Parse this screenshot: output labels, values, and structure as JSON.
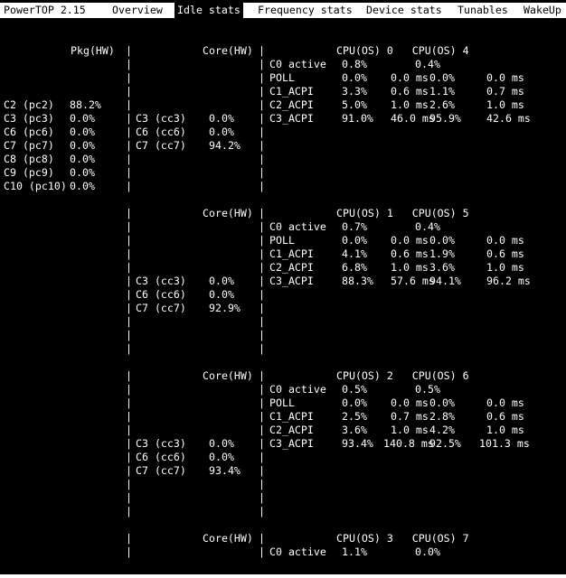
{
  "tabs": {
    "app_title": "PowerTOP 2.15",
    "overview": "Overview",
    "idle_stats": "Idle stats",
    "frequency_stats": "Frequency stats",
    "device_stats": "Device stats",
    "tunables": "Tunables",
    "wakeup": "WakeUp"
  },
  "separator": "|",
  "package": {
    "header": "Pkg(HW)",
    "states": [
      {
        "label": "C2 (pc2)",
        "value": "88.2%"
      },
      {
        "label": "C3 (pc3)",
        "value": "0.0%"
      },
      {
        "label": "C6 (pc6)",
        "value": "0.0%"
      },
      {
        "label": "C7 (pc7)",
        "value": "0.0%"
      },
      {
        "label": "C8 (pc8)",
        "value": "0.0%"
      },
      {
        "label": "C9 (pc9)",
        "value": "0.0%"
      },
      {
        "label": "C10 (pc10)",
        "value": "0.0%"
      }
    ]
  },
  "cores": [
    {
      "header": "Core(HW)",
      "cpu_header": "CPU(OS) 0   CPU(OS) 4",
      "core_states": [
        {
          "label": "C3 (cc3)",
          "value": "0.0%"
        },
        {
          "label": "C6 (cc6)",
          "value": "0.0%"
        },
        {
          "label": "C7 (cc7)",
          "value": "94.2%"
        }
      ],
      "c0": {
        "label": "C0 active",
        "a": "0.8%",
        "b": "0.4%"
      },
      "rows": [
        {
          "label": "POLL",
          "a_pct": "0.0%",
          "a_ms": "0.0 ms",
          "b_pct": "0.0%",
          "b_ms": "0.0 ms"
        },
        {
          "label": "C1_ACPI",
          "a_pct": "3.3%",
          "a_ms": "0.6 ms",
          "b_pct": "1.1%",
          "b_ms": "0.7 ms"
        },
        {
          "label": "C2_ACPI",
          "a_pct": "5.0%",
          "a_ms": "1.0 ms",
          "b_pct": "2.6%",
          "b_ms": "1.0 ms"
        },
        {
          "label": "C3_ACPI",
          "a_pct": "91.0%",
          "a_ms": "46.0 ms",
          "b_pct": "95.9%",
          "b_ms": "42.6 ms"
        }
      ]
    },
    {
      "header": "Core(HW)",
      "cpu_header": "CPU(OS) 1   CPU(OS) 5",
      "core_states": [
        {
          "label": "C3 (cc3)",
          "value": "0.0%"
        },
        {
          "label": "C6 (cc6)",
          "value": "0.0%"
        },
        {
          "label": "C7 (cc7)",
          "value": "92.9%"
        }
      ],
      "c0": {
        "label": "C0 active",
        "a": "0.7%",
        "b": "0.4%"
      },
      "rows": [
        {
          "label": "POLL",
          "a_pct": "0.0%",
          "a_ms": "0.0 ms",
          "b_pct": "0.0%",
          "b_ms": "0.0 ms"
        },
        {
          "label": "C1_ACPI",
          "a_pct": "4.1%",
          "a_ms": "0.6 ms",
          "b_pct": "1.9%",
          "b_ms": "0.6 ms"
        },
        {
          "label": "C2_ACPI",
          "a_pct": "6.8%",
          "a_ms": "1.0 ms",
          "b_pct": "3.6%",
          "b_ms": "1.0 ms"
        },
        {
          "label": "C3_ACPI",
          "a_pct": "88.3%",
          "a_ms": "57.6 ms",
          "b_pct": "94.1%",
          "b_ms": "96.2 ms"
        }
      ]
    },
    {
      "header": "Core(HW)",
      "cpu_header": "CPU(OS) 2   CPU(OS) 6",
      "core_states": [
        {
          "label": "C3 (cc3)",
          "value": "0.0%"
        },
        {
          "label": "C6 (cc6)",
          "value": "0.0%"
        },
        {
          "label": "C7 (cc7)",
          "value": "93.4%"
        }
      ],
      "c0": {
        "label": "C0 active",
        "a": "0.5%",
        "b": "0.5%"
      },
      "rows": [
        {
          "label": "POLL",
          "a_pct": "0.0%",
          "a_ms": "0.0 ms",
          "b_pct": "0.0%",
          "b_ms": "0.0 ms"
        },
        {
          "label": "C1_ACPI",
          "a_pct": "2.5%",
          "a_ms": "0.7 ms",
          "b_pct": "2.8%",
          "b_ms": "0.6 ms"
        },
        {
          "label": "C2_ACPI",
          "a_pct": "3.6%",
          "a_ms": "1.0 ms",
          "b_pct": "4.2%",
          "b_ms": "1.0 ms"
        },
        {
          "label": "C3_ACPI",
          "a_pct": "93.4%",
          "a_ms": "140.8 ms",
          "b_pct": "92.5%",
          "b_ms": "101.3 ms"
        }
      ]
    },
    {
      "header": "Core(HW)",
      "cpu_header": "CPU(OS) 3   CPU(OS) 7",
      "core_states": [],
      "c0": {
        "label": "C0 active",
        "a": "1.1%",
        "b": "0.0%"
      },
      "rows": []
    }
  ]
}
